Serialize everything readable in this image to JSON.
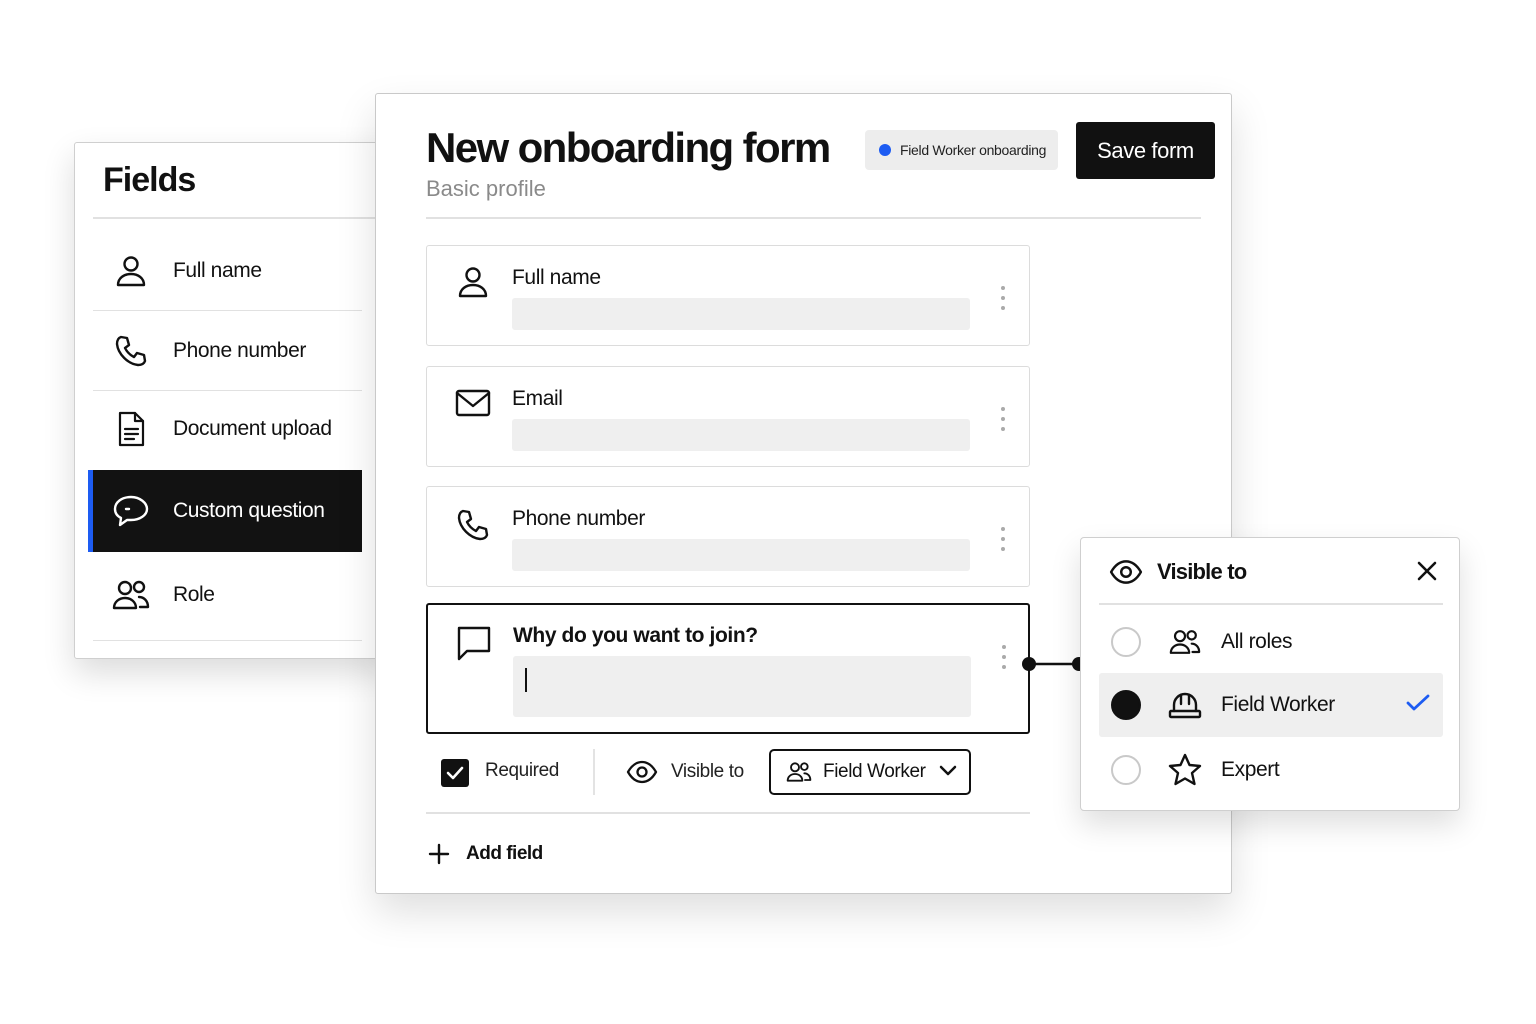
{
  "sidebar": {
    "title": "Fields",
    "items": [
      {
        "label": "Full name",
        "icon": "user-icon"
      },
      {
        "label": "Phone number",
        "icon": "phone-icon"
      },
      {
        "label": "Document upload",
        "icon": "document-icon"
      },
      {
        "label": "Custom question",
        "icon": "chat-bubble-icon",
        "active": true
      },
      {
        "label": "Role",
        "icon": "users-icon"
      }
    ]
  },
  "form": {
    "title": "New onboarding form",
    "subtitle": "Basic profile",
    "badge": "Field Worker onboarding",
    "save_label": "Save form",
    "fields": [
      {
        "label": "Full name",
        "icon": "user-icon"
      },
      {
        "label": "Email",
        "icon": "mail-icon"
      },
      {
        "label": "Phone number",
        "icon": "phone-icon"
      },
      {
        "label": "Why do you want to join?",
        "icon": "message-icon",
        "active": true
      }
    ],
    "options": {
      "required_label": "Required",
      "required_checked": true,
      "visible_label": "Visible to",
      "role_selected": "Field Worker"
    },
    "add_field_label": "Add field"
  },
  "visibility_panel": {
    "title": "Visible to",
    "options": [
      {
        "label": "All roles",
        "icon": "users-icon",
        "selected": false
      },
      {
        "label": "Field Worker",
        "icon": "hard-hat-icon",
        "selected": true
      },
      {
        "label": "Expert",
        "icon": "star-icon",
        "selected": false
      }
    ]
  },
  "colors": {
    "accent": "#1d5cf2",
    "dark": "#111111",
    "input_bg": "#efefef",
    "muted_text": "#8a8a8a"
  }
}
